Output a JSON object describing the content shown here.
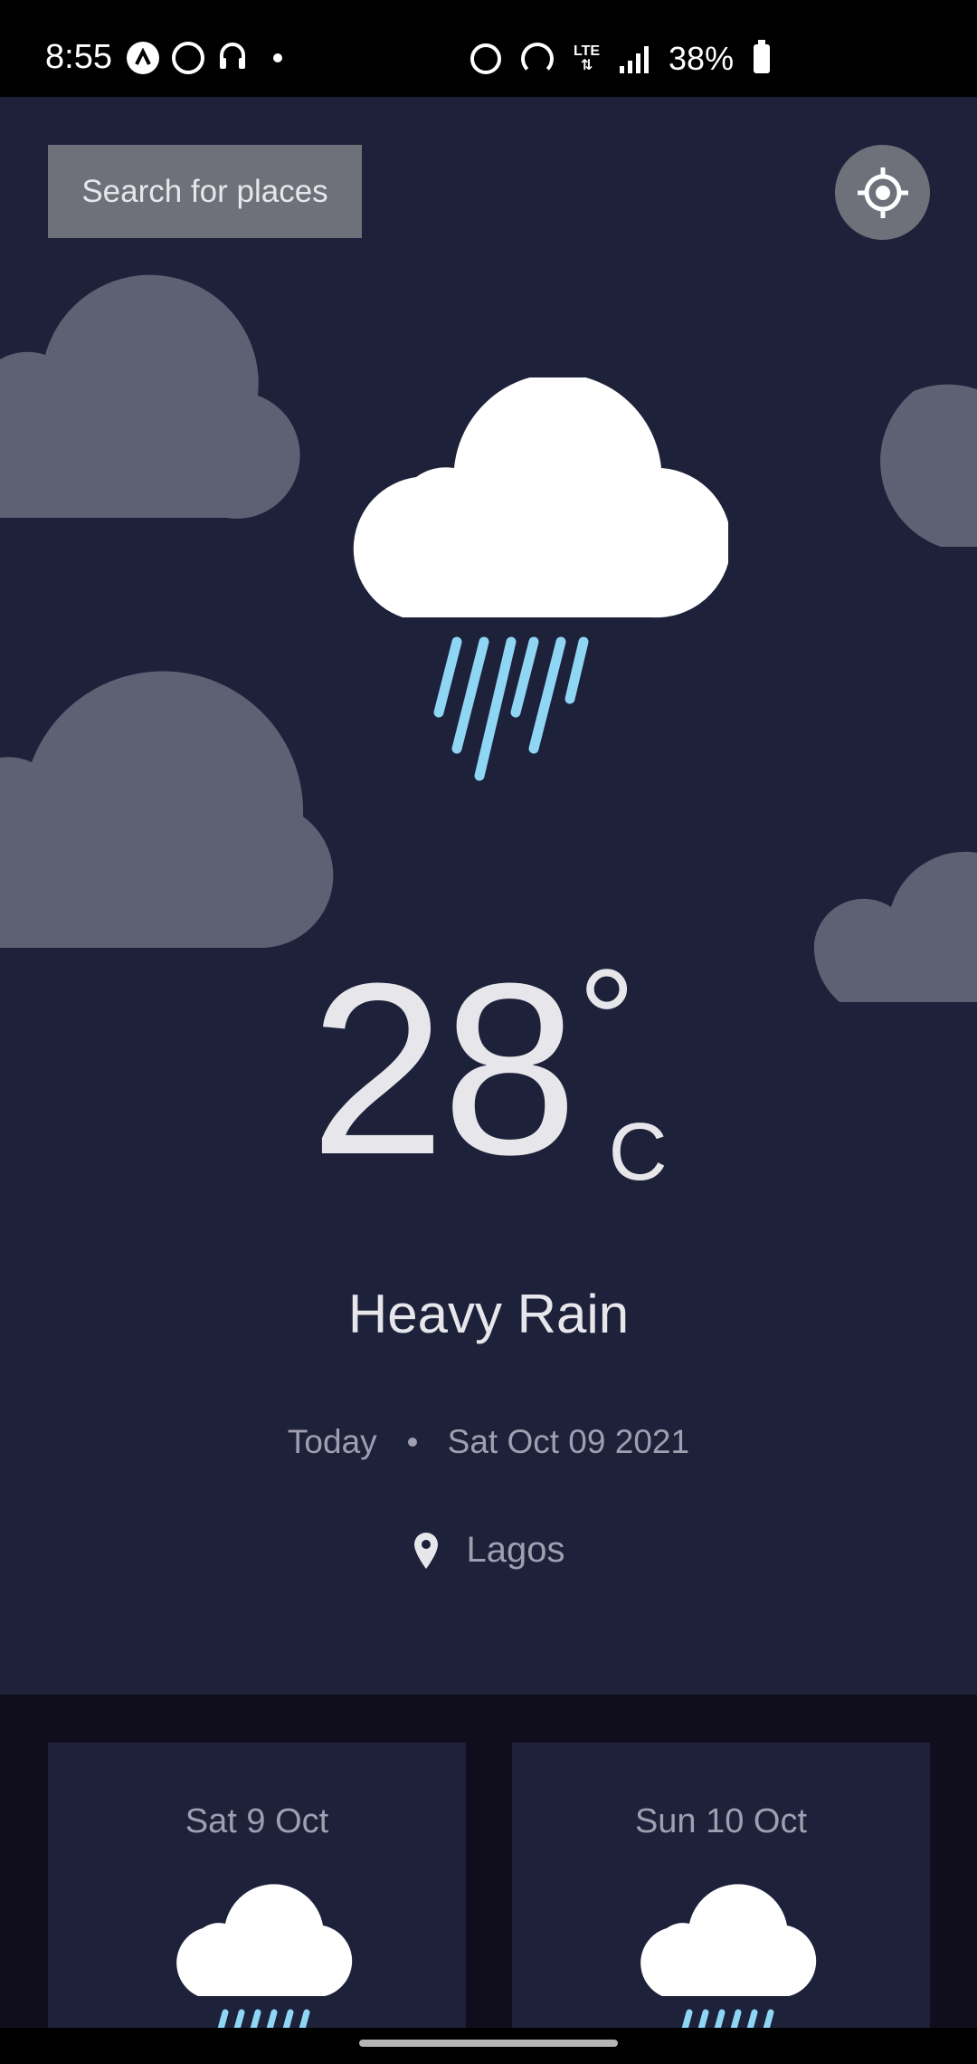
{
  "status_bar": {
    "time": "8:55",
    "lte": "LTE",
    "battery": "38%",
    "icons": [
      "app-a-icon",
      "whatsapp-icon",
      "headphones-icon",
      "notification-dot",
      "alarm-icon",
      "hotspot-icon",
      "lte-data-icon",
      "signal-icon",
      "battery-icon"
    ]
  },
  "header": {
    "search_label": "Search for places",
    "location_icon": "crosshair-location-icon"
  },
  "current": {
    "icon": "heavy-rain-icon",
    "temperature": "28",
    "degree_symbol": "°",
    "unit": "C",
    "condition": "Heavy Rain",
    "day_label": "Today",
    "date": "Sat Oct 09 2021",
    "location": "Lagos"
  },
  "forecast": [
    {
      "date": "Sat 9 Oct",
      "icon": "heavy-rain-icon"
    },
    {
      "date": "Sun 10 Oct",
      "icon": "heavy-rain-icon"
    }
  ],
  "colors": {
    "panel_bg": "#1e213a",
    "forecast_bg": "#100e1d",
    "button_bg": "#6e707a",
    "text_primary": "#e7e7eb",
    "text_secondary": "#a09fb1",
    "rain": "#8fd6f5",
    "cloud_bg": "#5e6073"
  }
}
